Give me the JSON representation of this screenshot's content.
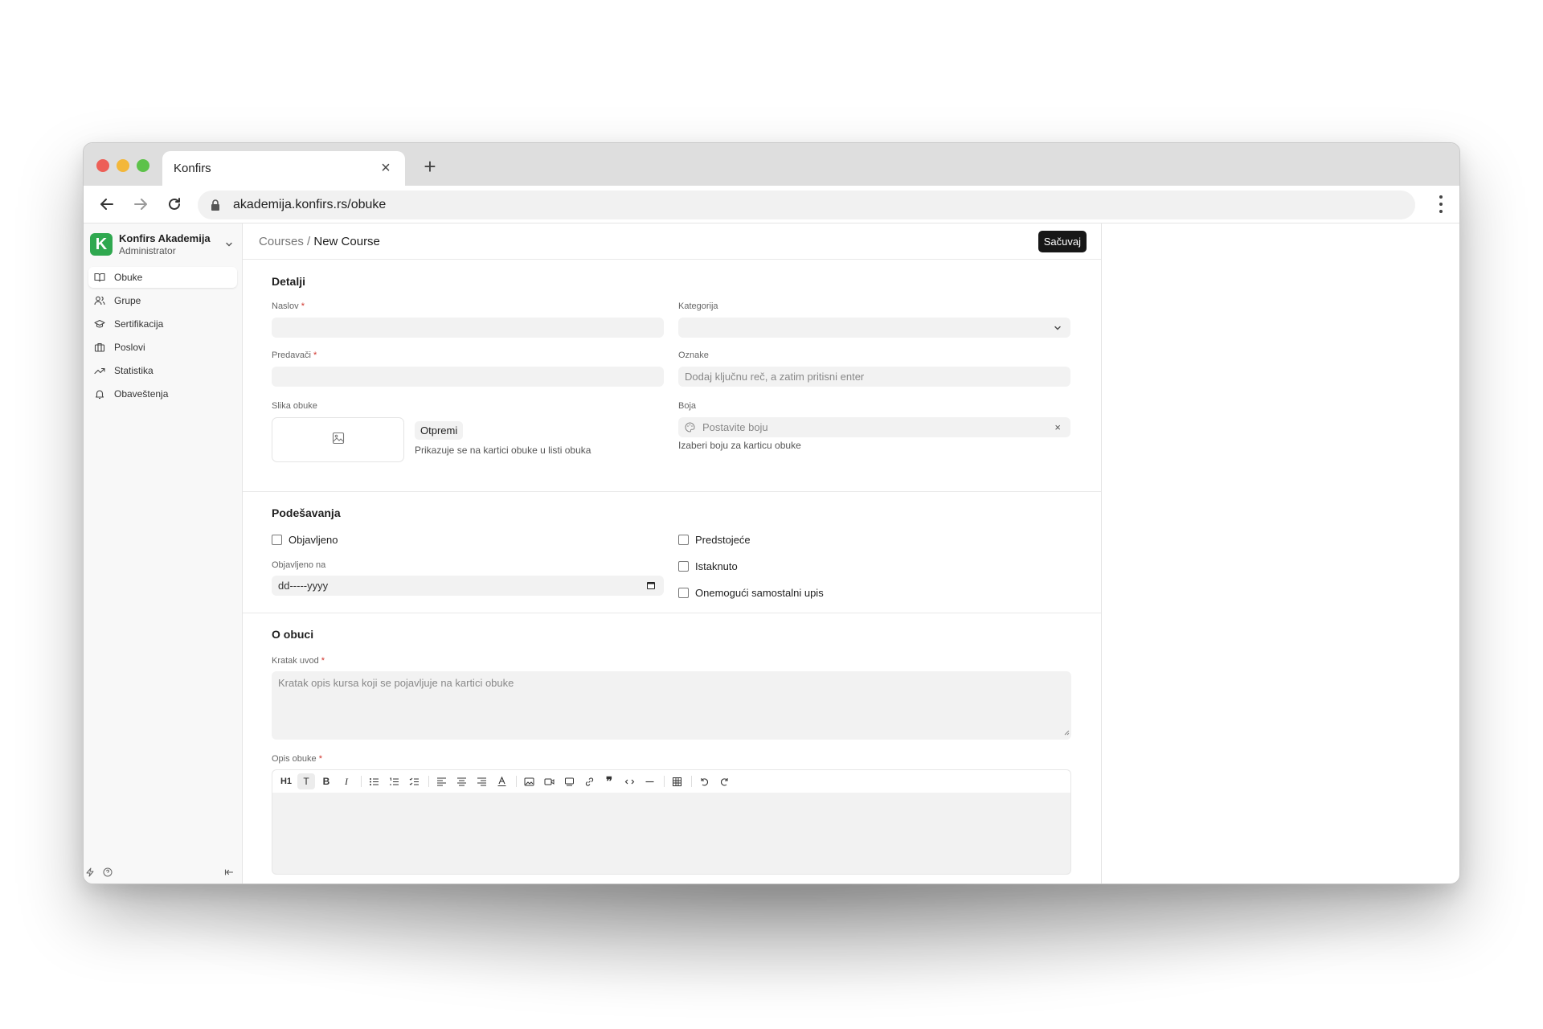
{
  "browser": {
    "tab_title": "Konfirs",
    "url": "akademija.konfirs.rs/obuke"
  },
  "brand": {
    "logo_letter": "K",
    "name": "Konfirs Akademija",
    "role": "Administrator"
  },
  "sidebar": {
    "items": [
      {
        "label": "Obuke",
        "icon": "book-open-icon",
        "active": true
      },
      {
        "label": "Grupe",
        "icon": "users-icon",
        "active": false
      },
      {
        "label": "Sertifikacija",
        "icon": "graduation-cap-icon",
        "active": false
      },
      {
        "label": "Poslovi",
        "icon": "briefcase-icon",
        "active": false
      },
      {
        "label": "Statistika",
        "icon": "trending-up-icon",
        "active": false
      },
      {
        "label": "Obaveštenja",
        "icon": "bell-icon",
        "active": false
      }
    ]
  },
  "header": {
    "breadcrumb_parent": "Courses",
    "breadcrumb_sep": " / ",
    "breadcrumb_current": "New Course",
    "save_label": "Sačuvaj"
  },
  "details": {
    "title": "Detalji",
    "naslov_label": "Naslov",
    "naslov_value": "",
    "kategorija_label": "Kategorija",
    "kategorija_value": "",
    "predavaci_label": "Predavači",
    "predavaci_value": "",
    "oznake_label": "Oznake",
    "oznake_placeholder": "Dodaj ključnu reč, a zatim pritisni enter",
    "slika_label": "Slika obuke",
    "upload_label": "Otpremi",
    "upload_hint": "Prikazuje se na kartici obuke u listi obuka",
    "boja_label": "Boja",
    "boja_placeholder": "Postavite boju",
    "boja_hint": "Izaberi boju za karticu obuke",
    "required_mark": "*"
  },
  "settings": {
    "title": "Podešavanja",
    "objavljeno_label": "Objavljeno",
    "objavljeno_na_label": "Objavljeno na",
    "date_placeholder": "dd-----yyyy",
    "predstojece_label": "Predstojeće",
    "istaknuto_label": "Istaknuto",
    "onemoguci_label": "Onemogući samostalni upis",
    "objavljeno_checked": false,
    "predstojece_checked": false,
    "istaknuto_checked": false,
    "onemoguci_checked": false
  },
  "about": {
    "title": "O obuci",
    "kratak_label": "Kratak uvod",
    "kratak_placeholder": "Kratak opis kursa koji se pojavljuje na kartici obuke",
    "opis_label": "Opis obuke",
    "toolbar_heading": "H1",
    "toolbar_text": "T",
    "toolbar_bold": "B",
    "toolbar_italic": "I"
  }
}
